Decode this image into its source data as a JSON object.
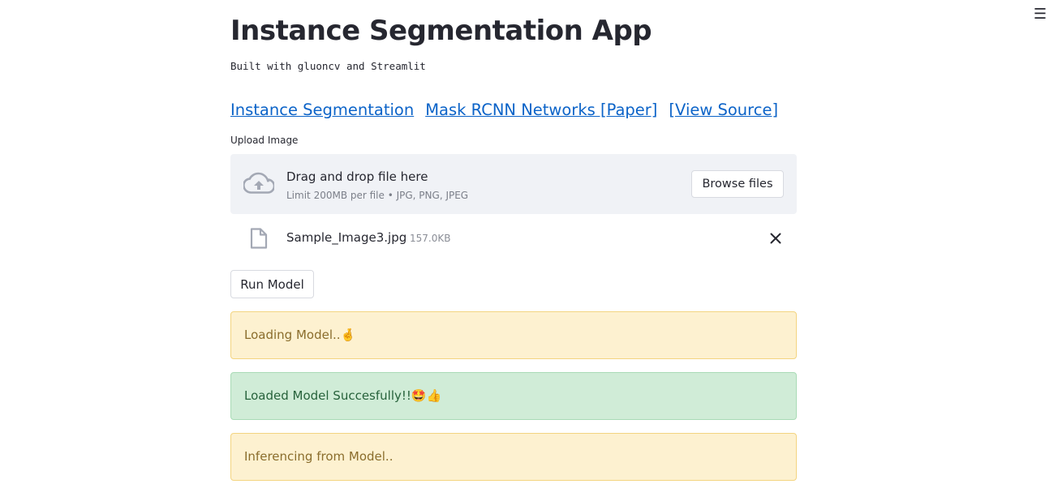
{
  "menu": {
    "icon": "hamburger-menu-icon",
    "glyph": "☰"
  },
  "header": {
    "title": "Instance Segmentation App",
    "subtitle": "Built with gluoncv and Streamlit"
  },
  "links": [
    {
      "label": "Instance Segmentation"
    },
    {
      "label": "Mask RCNN Networks [Paper]"
    },
    {
      "label": "[View Source]"
    }
  ],
  "uploader": {
    "label": "Upload Image",
    "drop_text": "Drag and drop file here",
    "limit_text": "Limit 200MB per file • JPG, PNG, JPEG",
    "browse_label": "Browse files",
    "icon": "cloud-upload-icon"
  },
  "uploaded_file": {
    "name": "Sample_Image3.jpg",
    "size": "157.0KB",
    "icon": "file-icon"
  },
  "run_button": {
    "label": "Run Model"
  },
  "alerts": [
    {
      "type": "warning",
      "text": "Loading Model..🤞"
    },
    {
      "type": "success",
      "text": "Loaded Model Succesfully!!🤩👍"
    },
    {
      "type": "warning",
      "text": "Inferencing from Model.."
    }
  ],
  "colors": {
    "link": "#0b63c8",
    "warning_bg": "#fdf1d0",
    "success_bg": "#d0ecd7",
    "dropzone_bg": "#f0f2f6"
  }
}
